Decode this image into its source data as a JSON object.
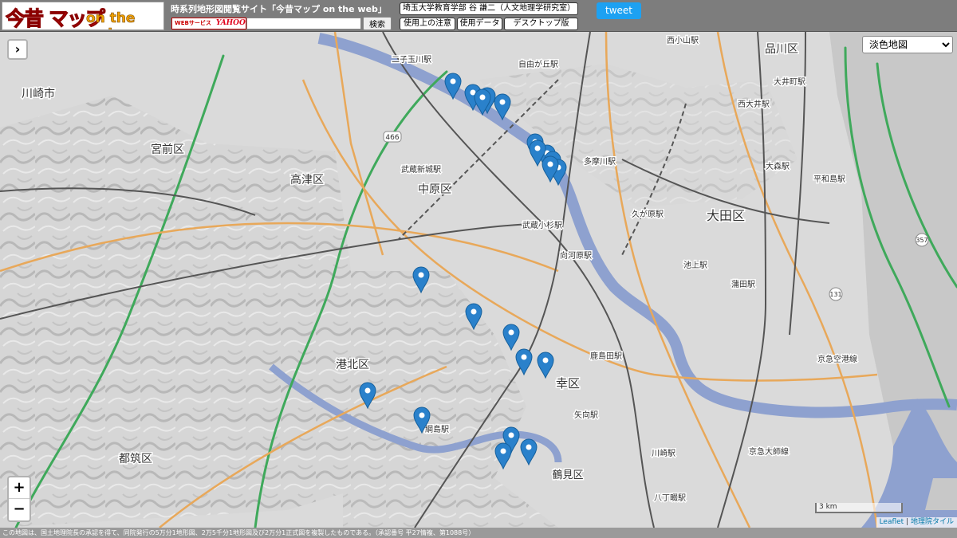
{
  "header": {
    "logo_imamukashi": "今昔",
    "logo_map": "マップ",
    "logo_ontheweb": "on the web",
    "site_title": "時系列地形図閲覧サイト「今昔マップ on the web」",
    "yahoo_badge": "WEBサービス",
    "yahoo_logo": "YAHOO!",
    "search_value": "",
    "search_button": "検索",
    "author_link": "埼玉大学教育学部 谷 謙二（人文地理学研究室）",
    "usage_notes_link": "使用上の注意",
    "usage_data_link": "使用データ",
    "desktop_link": "デスクトップ版",
    "tweet_button": "tweet"
  },
  "map": {
    "layer_options": [
      "淡色地図"
    ],
    "layer_selected": "淡色地図",
    "expand_icon": "›",
    "zoom_in": "+",
    "zoom_out": "−",
    "scale_label": "3 km",
    "attribution_leaflet": "Leaflet",
    "attribution_separator": " | ",
    "attribution_gsi": "地理院タイル",
    "marker_count": 21,
    "labels": {
      "kawasaki_city": "川崎市",
      "miyamae": "宮前区",
      "takatsu": "高津区",
      "nakahara": "中原区",
      "ota": "大田区",
      "kohoku": "港北区",
      "tsuzuki": "都筑区",
      "saiwai": "幸区",
      "tsurumi": "鶴見区",
      "shinagawa": "品川区",
      "futakotamagawa_sta": "二子玉川駅",
      "jiyugaoka_sta": "自由が丘駅",
      "tamagawa_sta": "多摩川駅",
      "musashikosugi_sta": "武蔵小杉駅",
      "musashishinjo_sta": "武蔵新城駅",
      "mukaigawara_sta": "向河原駅",
      "kugahara_sta": "久が原駅",
      "ikegami_sta": "池上駅",
      "kamata_sta": "蒲田駅",
      "kashimada_sta": "鹿島田駅",
      "tsunashima_sta": "綱島駅",
      "yaguchi_sta": "矢向駅",
      "kawasaki_sta": "川崎駅",
      "hatchonawate_sta": "八丁畷駅",
      "omorimachi_sta": "大井町駅",
      "nishioimachi_sta": "西大井駅",
      "heiwajima_sta": "平和島駅",
      "nishikoyama_sta": "西小山駅",
      "omori_sta": "大森駅",
      "bypass": "466",
      "route_131": "131",
      "route_357": "357",
      "expressway_daishi": "京急大師線",
      "keihin": "京急空港線"
    }
  },
  "footer": {
    "note": "この地図は、国土地理院長の承認を得て、同院発行の5万分1地形図、2万5千分1地形図及び2万分1正式図を複製したものである。（承認番号 平27情複、第1088号）"
  }
}
